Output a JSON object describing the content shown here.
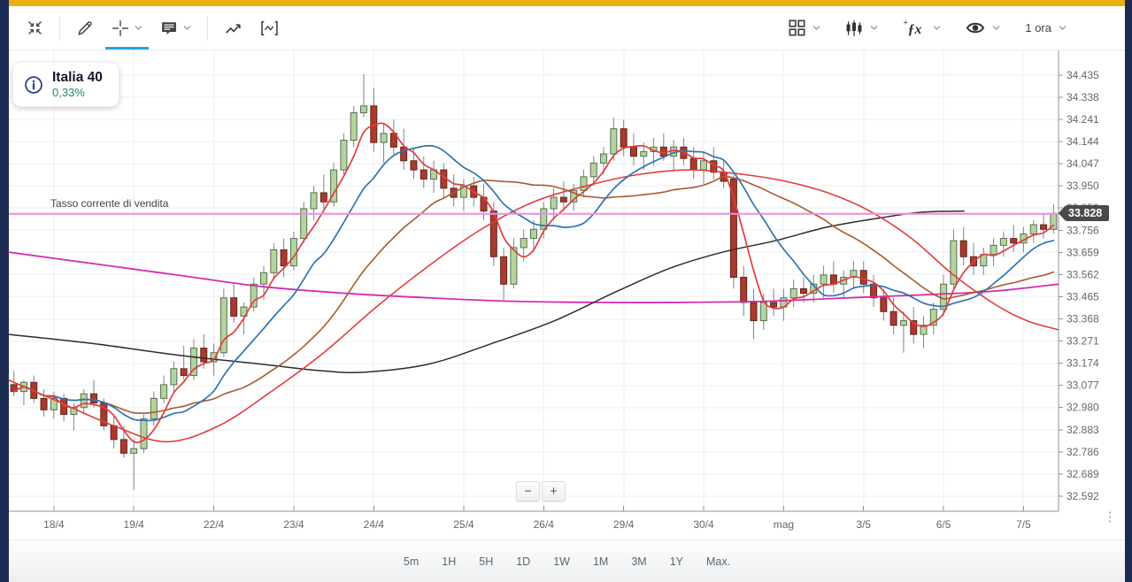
{
  "window": {
    "accent_gold": "#e9b10e",
    "frame_navy": "#1c2b52"
  },
  "toolbar": {
    "interval_label": "1 ora",
    "fx_glyph": "ƒx",
    "fx_plus": "+"
  },
  "instrument": {
    "name": "Italia 40",
    "change": "0,33%"
  },
  "sell_rate": {
    "label": "Tasso corrente di vendita",
    "price_label": "33.828",
    "value": 33.828
  },
  "zoom_controls": {
    "minus": "−",
    "plus": "+"
  },
  "axis_menu": {
    "glyph": "⋮"
  },
  "timeframes": [
    "5m",
    "1H",
    "5H",
    "1D",
    "1W",
    "1M",
    "3M",
    "1Y",
    "Max."
  ],
  "chart_data": {
    "type": "candlestick",
    "title": "Italia 40",
    "interval": "1 ora",
    "grid": true,
    "y_ticks": [
      "34.435",
      "34.338",
      "34.241",
      "34.144",
      "34.047",
      "33.950",
      "33.853",
      "33.756",
      "33.659",
      "33.562",
      "33.465",
      "33.368",
      "33.271",
      "33.174",
      "33.077",
      "32.980",
      "32.883",
      "32.786",
      "32.689",
      "32.592"
    ],
    "x_ticks": [
      {
        "label": "18/4",
        "index": 4
      },
      {
        "label": "19/4",
        "index": 12
      },
      {
        "label": "22/4",
        "index": 20
      },
      {
        "label": "23/4",
        "index": 28
      },
      {
        "label": "24/4",
        "index": 36
      },
      {
        "label": "25/4",
        "index": 45
      },
      {
        "label": "26/4",
        "index": 53
      },
      {
        "label": "29/4",
        "index": 61
      },
      {
        "label": "30/4",
        "index": 69
      },
      {
        "label": "mag",
        "index": 77
      },
      {
        "label": "3/5",
        "index": 85
      },
      {
        "label": "6/5",
        "index": 93
      },
      {
        "label": "7/5",
        "index": 101
      }
    ],
    "price_top": 34.543,
    "price_bottom": 32.526,
    "current_price": 33.828,
    "candles": [
      [
        33.08,
        33.14,
        33.03,
        33.05
      ],
      [
        33.05,
        33.1,
        32.99,
        33.09
      ],
      [
        33.09,
        33.12,
        33.0,
        33.02
      ],
      [
        33.02,
        33.06,
        32.94,
        32.97
      ],
      [
        32.97,
        33.05,
        32.93,
        33.02
      ],
      [
        33.02,
        33.04,
        32.92,
        32.95
      ],
      [
        32.95,
        33.0,
        32.88,
        32.98
      ],
      [
        32.98,
        33.06,
        32.95,
        33.04
      ],
      [
        33.04,
        33.1,
        32.98,
        33.0
      ],
      [
        33.0,
        33.02,
        32.88,
        32.9
      ],
      [
        32.9,
        32.94,
        32.8,
        32.84
      ],
      [
        32.84,
        32.9,
        32.76,
        32.78
      ],
      [
        32.78,
        32.84,
        32.62,
        32.8
      ],
      [
        32.8,
        32.95,
        32.78,
        32.93
      ],
      [
        32.93,
        33.05,
        32.9,
        33.02
      ],
      [
        33.02,
        33.12,
        33.0,
        33.08
      ],
      [
        33.08,
        33.18,
        33.05,
        33.15
      ],
      [
        33.15,
        33.25,
        33.1,
        33.12
      ],
      [
        33.12,
        33.28,
        33.1,
        33.24
      ],
      [
        33.24,
        33.3,
        33.15,
        33.18
      ],
      [
        33.18,
        33.26,
        33.12,
        33.22
      ],
      [
        33.22,
        33.5,
        33.2,
        33.46
      ],
      [
        33.46,
        33.52,
        33.35,
        33.38
      ],
      [
        33.38,
        33.44,
        33.3,
        33.42
      ],
      [
        33.42,
        33.55,
        33.4,
        33.52
      ],
      [
        33.52,
        33.6,
        33.45,
        33.57
      ],
      [
        33.57,
        33.7,
        33.54,
        33.67
      ],
      [
        33.67,
        33.72,
        33.55,
        33.6
      ],
      [
        33.6,
        33.75,
        33.58,
        33.72
      ],
      [
        33.72,
        33.88,
        33.7,
        33.85
      ],
      [
        33.85,
        33.95,
        33.8,
        33.92
      ],
      [
        33.92,
        34.0,
        33.85,
        33.88
      ],
      [
        33.88,
        34.05,
        33.86,
        34.02
      ],
      [
        34.02,
        34.18,
        34.0,
        34.15
      ],
      [
        34.15,
        34.3,
        34.12,
        34.27
      ],
      [
        34.27,
        34.44,
        34.25,
        34.3
      ],
      [
        34.3,
        34.38,
        34.1,
        34.14
      ],
      [
        34.14,
        34.22,
        34.05,
        34.18
      ],
      [
        34.18,
        34.24,
        34.08,
        34.12
      ],
      [
        34.12,
        34.2,
        34.02,
        34.06
      ],
      [
        34.06,
        34.12,
        33.98,
        34.02
      ],
      [
        34.02,
        34.08,
        33.94,
        33.98
      ],
      [
        33.98,
        34.06,
        33.92,
        34.02
      ],
      [
        34.02,
        34.05,
        33.9,
        33.94
      ],
      [
        33.94,
        34.0,
        33.86,
        33.9
      ],
      [
        33.9,
        33.98,
        33.84,
        33.95
      ],
      [
        33.95,
        33.99,
        33.86,
        33.9
      ],
      [
        33.9,
        33.96,
        33.8,
        33.84
      ],
      [
        33.84,
        33.88,
        33.6,
        33.64
      ],
      [
        33.64,
        33.68,
        33.45,
        33.52
      ],
      [
        33.52,
        33.72,
        33.5,
        33.68
      ],
      [
        33.68,
        33.76,
        33.62,
        33.72
      ],
      [
        33.72,
        33.8,
        33.66,
        33.76
      ],
      [
        33.76,
        33.88,
        33.72,
        33.85
      ],
      [
        33.85,
        33.94,
        33.8,
        33.9
      ],
      [
        33.9,
        33.97,
        33.84,
        33.88
      ],
      [
        33.88,
        33.96,
        33.84,
        33.93
      ],
      [
        33.93,
        34.02,
        33.9,
        33.99
      ],
      [
        33.99,
        34.08,
        33.95,
        34.05
      ],
      [
        34.05,
        34.12,
        34.0,
        34.09
      ],
      [
        34.09,
        34.25,
        34.06,
        34.2
      ],
      [
        34.2,
        34.24,
        34.08,
        34.12
      ],
      [
        34.12,
        34.18,
        34.04,
        34.08
      ],
      [
        34.08,
        34.14,
        34.02,
        34.1
      ],
      [
        34.1,
        34.16,
        34.04,
        34.12
      ],
      [
        34.12,
        34.18,
        34.06,
        34.08
      ],
      [
        34.08,
        34.15,
        34.02,
        34.12
      ],
      [
        34.12,
        34.16,
        34.04,
        34.07
      ],
      [
        34.07,
        34.12,
        33.98,
        34.02
      ],
      [
        34.02,
        34.1,
        33.96,
        34.06
      ],
      [
        34.06,
        34.12,
        33.98,
        34.01
      ],
      [
        34.01,
        34.06,
        33.94,
        33.97
      ],
      [
        33.98,
        34.0,
        33.5,
        33.55
      ],
      [
        33.55,
        33.6,
        33.38,
        33.44
      ],
      [
        33.44,
        33.5,
        33.28,
        33.36
      ],
      [
        33.36,
        33.48,
        33.32,
        33.44
      ],
      [
        33.44,
        33.5,
        33.38,
        33.42
      ],
      [
        33.42,
        33.5,
        33.36,
        33.46
      ],
      [
        33.46,
        33.54,
        33.42,
        33.5
      ],
      [
        33.5,
        33.55,
        33.44,
        33.48
      ],
      [
        33.48,
        33.56,
        33.44,
        33.52
      ],
      [
        33.52,
        33.6,
        33.46,
        33.56
      ],
      [
        33.56,
        33.62,
        33.48,
        33.52
      ],
      [
        33.52,
        33.58,
        33.46,
        33.55
      ],
      [
        33.55,
        33.62,
        33.5,
        33.58
      ],
      [
        33.58,
        33.62,
        33.48,
        33.52
      ],
      [
        33.52,
        33.56,
        33.42,
        33.46
      ],
      [
        33.46,
        33.5,
        33.36,
        33.4
      ],
      [
        33.4,
        33.46,
        33.3,
        33.34
      ],
      [
        33.34,
        33.4,
        33.22,
        33.36
      ],
      [
        33.36,
        33.42,
        33.26,
        33.3
      ],
      [
        33.3,
        33.38,
        33.24,
        33.34
      ],
      [
        33.34,
        33.44,
        33.3,
        33.41
      ],
      [
        33.41,
        33.56,
        33.38,
        33.52
      ],
      [
        33.52,
        33.76,
        33.5,
        33.71
      ],
      [
        33.71,
        33.77,
        33.6,
        33.64
      ],
      [
        33.64,
        33.7,
        33.56,
        33.6
      ],
      [
        33.6,
        33.68,
        33.56,
        33.65
      ],
      [
        33.65,
        33.72,
        33.6,
        33.69
      ],
      [
        33.69,
        33.75,
        33.64,
        33.72
      ],
      [
        33.72,
        33.78,
        33.66,
        33.7
      ],
      [
        33.7,
        33.77,
        33.66,
        33.74
      ],
      [
        33.74,
        33.8,
        33.7,
        33.78
      ],
      [
        33.78,
        33.83,
        33.72,
        33.76
      ],
      [
        33.76,
        33.87,
        33.74,
        33.83
      ]
    ],
    "overlays": {
      "computed_sma": [
        {
          "name": "ma-brown",
          "period": 22,
          "color": "#a85b2d",
          "width": 1.6
        },
        {
          "name": "ma-blue",
          "period": 10,
          "color": "#2e74b5",
          "width": 1.7
        },
        {
          "name": "ma-fast-red",
          "period": 4,
          "color": "#e23d3d",
          "width": 1.7
        }
      ],
      "polylines": [
        {
          "name": "ma-long-magenta",
          "color": "#d62bb0",
          "width": 1.8,
          "points": [
            [
              0,
              33.66
            ],
            [
              0.08,
              33.61
            ],
            [
              0.16,
              33.56
            ],
            [
              0.24,
              33.51
            ],
            [
              0.32,
              33.48
            ],
            [
              0.4,
              33.46
            ],
            [
              0.48,
              33.445
            ],
            [
              0.56,
              33.44
            ],
            [
              0.64,
              33.44
            ],
            [
              0.72,
              33.445
            ],
            [
              0.8,
              33.46
            ],
            [
              0.88,
              33.475
            ],
            [
              0.94,
              33.49
            ],
            [
              1,
              33.52
            ]
          ]
        },
        {
          "name": "ma-long-black",
          "color": "#2d2d2d",
          "width": 1.5,
          "points": [
            [
              0,
              33.3
            ],
            [
              0.08,
              33.26
            ],
            [
              0.16,
              33.21
            ],
            [
              0.24,
              33.17
            ],
            [
              0.3,
              33.14
            ],
            [
              0.34,
              33.135
            ],
            [
              0.4,
              33.17
            ],
            [
              0.46,
              33.26
            ],
            [
              0.52,
              33.36
            ],
            [
              0.58,
              33.49
            ],
            [
              0.63,
              33.59
            ],
            [
              0.68,
              33.66
            ],
            [
              0.73,
              33.71
            ],
            [
              0.78,
              33.77
            ],
            [
              0.83,
              33.81
            ],
            [
              0.87,
              33.835
            ],
            [
              0.91,
              33.84
            ]
          ]
        },
        {
          "name": "ma-long-red",
          "color": "#e23d3d",
          "width": 1.6,
          "points": [
            [
              0,
              33.1
            ],
            [
              0.05,
              33.0
            ],
            [
              0.1,
              32.9
            ],
            [
              0.15,
              32.83
            ],
            [
              0.2,
              32.9
            ],
            [
              0.25,
              33.05
            ],
            [
              0.3,
              33.22
            ],
            [
              0.35,
              33.42
            ],
            [
              0.4,
              33.6
            ],
            [
              0.45,
              33.76
            ],
            [
              0.5,
              33.88
            ],
            [
              0.55,
              33.95
            ],
            [
              0.6,
              34.0
            ],
            [
              0.65,
              34.02
            ],
            [
              0.7,
              34.0
            ],
            [
              0.74,
              33.97
            ],
            [
              0.78,
              33.92
            ],
            [
              0.82,
              33.84
            ],
            [
              0.86,
              33.72
            ],
            [
              0.9,
              33.56
            ],
            [
              0.94,
              33.43
            ],
            [
              0.97,
              33.36
            ],
            [
              1,
              33.32
            ]
          ]
        }
      ]
    },
    "colors": {
      "up_fill": "#b5d3a0",
      "up_border": "#57714f",
      "down_fill": "#a93a2d",
      "down_border": "#63241a",
      "wick": "#7d8488",
      "grid": "#ededf0",
      "axis": "#8f959b",
      "label": "#63676b",
      "price_line": "#ef8ce5",
      "badge_bg": "#4a4a4a"
    }
  }
}
